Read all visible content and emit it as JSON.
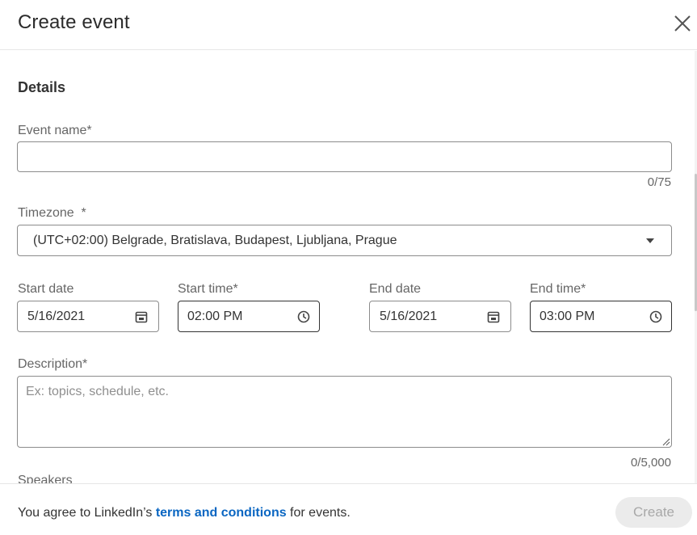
{
  "header": {
    "title": "Create event",
    "close_icon": "close-icon"
  },
  "details": {
    "section_title": "Details",
    "event_name": {
      "label": "Event name",
      "required_mark": "*",
      "value": "",
      "counter": "0/75"
    },
    "timezone": {
      "label": "Timezone",
      "required_mark": "*",
      "selected": "(UTC+02:00) Belgrade, Bratislava, Budapest, Ljubljana, Prague",
      "icon": "caret-down-icon"
    },
    "start_date": {
      "label": "Start date",
      "value": "5/16/2021",
      "icon": "calendar-icon"
    },
    "start_time": {
      "label": "Start time",
      "required_mark": "*",
      "value": "02:00 PM",
      "icon": "clock-icon"
    },
    "end_date": {
      "label": "End date",
      "value": "5/16/2021",
      "icon": "calendar-icon"
    },
    "end_time": {
      "label": "End time",
      "required_mark": "*",
      "value": "03:00 PM",
      "icon": "clock-icon"
    },
    "description": {
      "label": "Description",
      "required_mark": "*",
      "placeholder": "Ex: topics, schedule, etc.",
      "counter": "0/5,000"
    },
    "speakers": {
      "label": "Speakers"
    }
  },
  "footer": {
    "agree_prefix": "You agree to LinkedIn’s ",
    "terms_link": "terms and conditions",
    "agree_suffix": " for events.",
    "create_label": "Create"
  },
  "colors": {
    "link": "#0a66c2",
    "border": "#8c8c8c",
    "disabled_button_bg": "#ebebeb",
    "disabled_button_text": "#a8a8a8"
  }
}
